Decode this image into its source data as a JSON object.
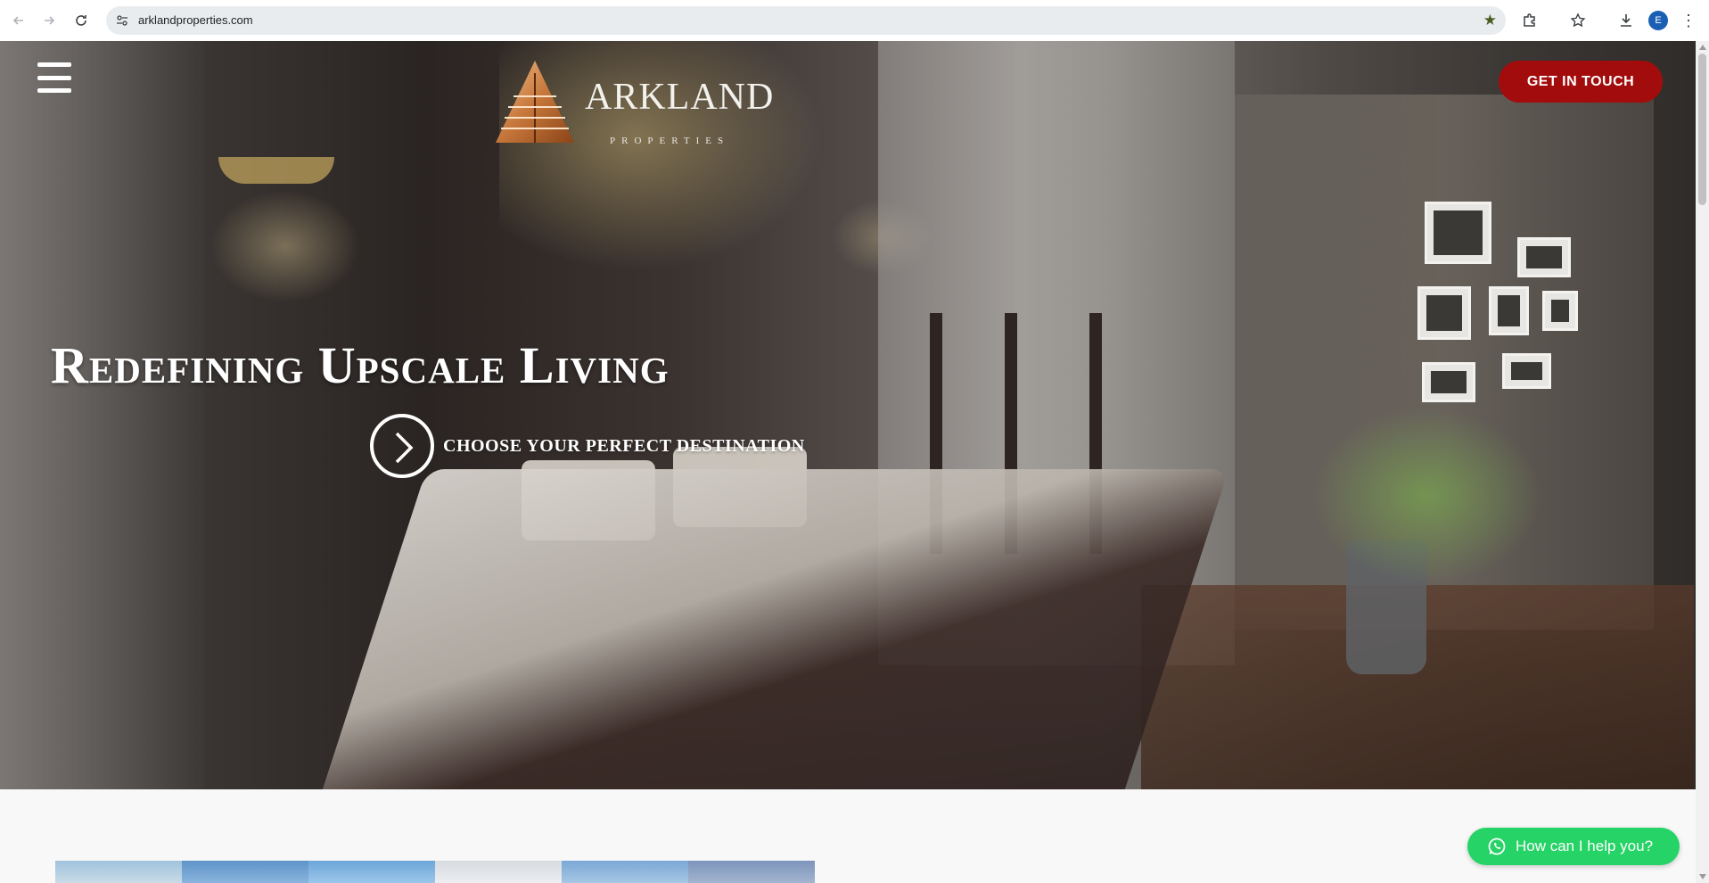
{
  "browser": {
    "url": "arklandproperties.com",
    "profile_initial": "E"
  },
  "header": {
    "logo_name": "ARKLAND",
    "logo_sub": "PROPERTIES",
    "cta_label": "GET IN TOUCH"
  },
  "hero": {
    "title": "Redefining Upscale Living",
    "destination_label": "CHOOSE YOUR PERFECT DESTINATION"
  },
  "chat": {
    "label": "How can I help you?"
  },
  "colors": {
    "cta": "#a30c0c",
    "whatsapp": "#25d366",
    "bookmark_star": "#4a5d23"
  }
}
